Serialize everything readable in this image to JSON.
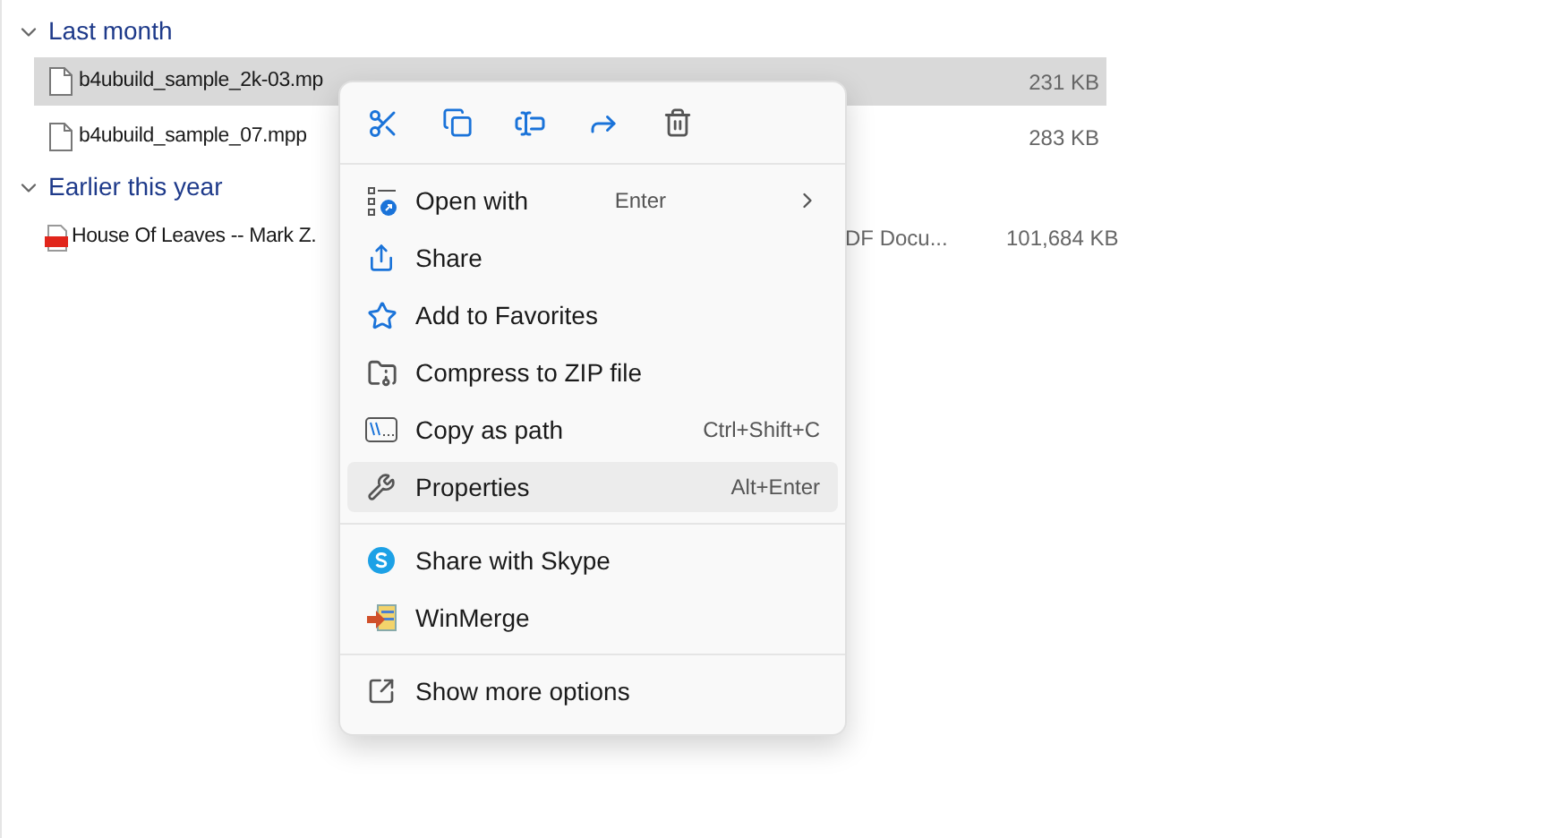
{
  "groups": [
    {
      "title": "Last month",
      "expanded": true,
      "files": [
        {
          "name": "b4ubuild_sample_2k-03.mp",
          "size": "231 KB",
          "kind": "doc",
          "selected": true
        },
        {
          "name": "b4ubuild_sample_07.mpp",
          "size": "283 KB",
          "kind": "doc",
          "selected": false
        }
      ]
    },
    {
      "title": "Earlier this year",
      "expanded": true,
      "files": [
        {
          "name": "House Of Leaves -- Mark Z.",
          "type": "DF Docu...",
          "size": "101,684 KB",
          "kind": "pdf",
          "selected": false
        }
      ]
    }
  ],
  "context_menu": {
    "sections": [
      [
        {
          "label": "Open with",
          "shortcut": "Enter",
          "submenu": true,
          "selected": false
        },
        {
          "label": "Share",
          "selected": false
        },
        {
          "label": "Add to Favorites",
          "selected": false
        },
        {
          "label": "Compress to ZIP file",
          "selected": false
        },
        {
          "label": "Copy as path",
          "shortcut": "Ctrl+Shift+C",
          "selected": false
        },
        {
          "label": "Properties",
          "shortcut": "Alt+Enter",
          "selected": true
        }
      ],
      [
        {
          "label": "Share with Skype",
          "selected": false
        },
        {
          "label": "WinMerge",
          "selected": false
        }
      ],
      [
        {
          "label": "Show more options",
          "selected": false
        }
      ]
    ]
  }
}
